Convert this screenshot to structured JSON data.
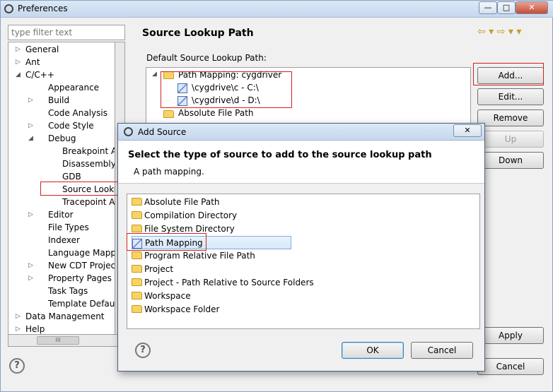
{
  "window": {
    "title": "Preferences",
    "min_glyph": "—",
    "max_glyph": "□",
    "close_glyph": "✕"
  },
  "left": {
    "filter_placeholder": "type filter text",
    "scroll_glyph": "III",
    "tree": [
      {
        "label": "General",
        "level": 0,
        "arrow": "▷"
      },
      {
        "label": "Ant",
        "level": 0,
        "arrow": "▷"
      },
      {
        "label": "C/C++",
        "level": 0,
        "arrow": "◢"
      },
      {
        "label": "Appearance",
        "level": 1,
        "arrow": ""
      },
      {
        "label": "Build",
        "level": 1,
        "arrow": "▷"
      },
      {
        "label": "Code Analysis",
        "level": 1,
        "arrow": ""
      },
      {
        "label": "Code Style",
        "level": 1,
        "arrow": "▷"
      },
      {
        "label": "Debug",
        "level": 1,
        "arrow": "◢"
      },
      {
        "label": "Breakpoint Actio",
        "level": 2,
        "arrow": ""
      },
      {
        "label": "Disassembly",
        "level": 2,
        "arrow": ""
      },
      {
        "label": "GDB",
        "level": 2,
        "arrow": ""
      },
      {
        "label": "Source Lookup P",
        "level": 2,
        "arrow": ""
      },
      {
        "label": "Tracepoint Actio",
        "level": 2,
        "arrow": ""
      },
      {
        "label": "Editor",
        "level": 1,
        "arrow": "▷"
      },
      {
        "label": "File Types",
        "level": 1,
        "arrow": ""
      },
      {
        "label": "Indexer",
        "level": 1,
        "arrow": ""
      },
      {
        "label": "Language Mappings",
        "level": 1,
        "arrow": ""
      },
      {
        "label": "New CDT Project Wi",
        "level": 1,
        "arrow": "▷"
      },
      {
        "label": "Property Pages Setti",
        "level": 1,
        "arrow": "▷"
      },
      {
        "label": "Task Tags",
        "level": 1,
        "arrow": ""
      },
      {
        "label": "Template Default Va",
        "level": 1,
        "arrow": ""
      },
      {
        "label": "Data Management",
        "level": 0,
        "arrow": "▷"
      },
      {
        "label": "Help",
        "level": 0,
        "arrow": "▷"
      }
    ]
  },
  "right": {
    "title": "Source Lookup Path",
    "nav_arrows": "⇦ ▾ ⇨ ▾ ▾",
    "default_label": "Default Source Lookup Path:",
    "lookup_items": {
      "path_mapping": "Path Mapping: cygdriver",
      "c_map": "\\cygdrive\\c - C:\\",
      "d_map": "\\cygdrive\\d - D:\\",
      "absolute": "Absolute File Path",
      "expand_glyph": "◢"
    },
    "buttons": {
      "add": "Add...",
      "edit": "Edit...",
      "remove": "Remove",
      "up": "Up",
      "down": "Down",
      "apply": "Apply",
      "cancel": "Cancel"
    },
    "help_glyph": "?"
  },
  "dialog": {
    "title": "Add Source",
    "close_glyph": "✕",
    "heading": "Select the type of source to add to the source lookup path",
    "description": "A path mapping.",
    "items": [
      {
        "label": "Absolute File Path",
        "icon": "folder-icon"
      },
      {
        "label": "Compilation Directory",
        "icon": "folder-icon"
      },
      {
        "label": "File System Directory",
        "icon": "folder-icon"
      },
      {
        "label": "Path Mapping",
        "icon": "path-mapping-icon",
        "selected": true
      },
      {
        "label": "Program Relative File Path",
        "icon": "folder-icon"
      },
      {
        "label": "Project",
        "icon": "folder-icon"
      },
      {
        "label": "Project - Path Relative to Source Folders",
        "icon": "folder-icon"
      },
      {
        "label": "Workspace",
        "icon": "folder-icon"
      },
      {
        "label": "Workspace Folder",
        "icon": "folder-icon"
      }
    ],
    "ok": "OK",
    "cancel": "Cancel",
    "help_glyph": "?"
  },
  "colors": {
    "highlight_red": "#d02020",
    "selection_blue": "#84acdd"
  }
}
